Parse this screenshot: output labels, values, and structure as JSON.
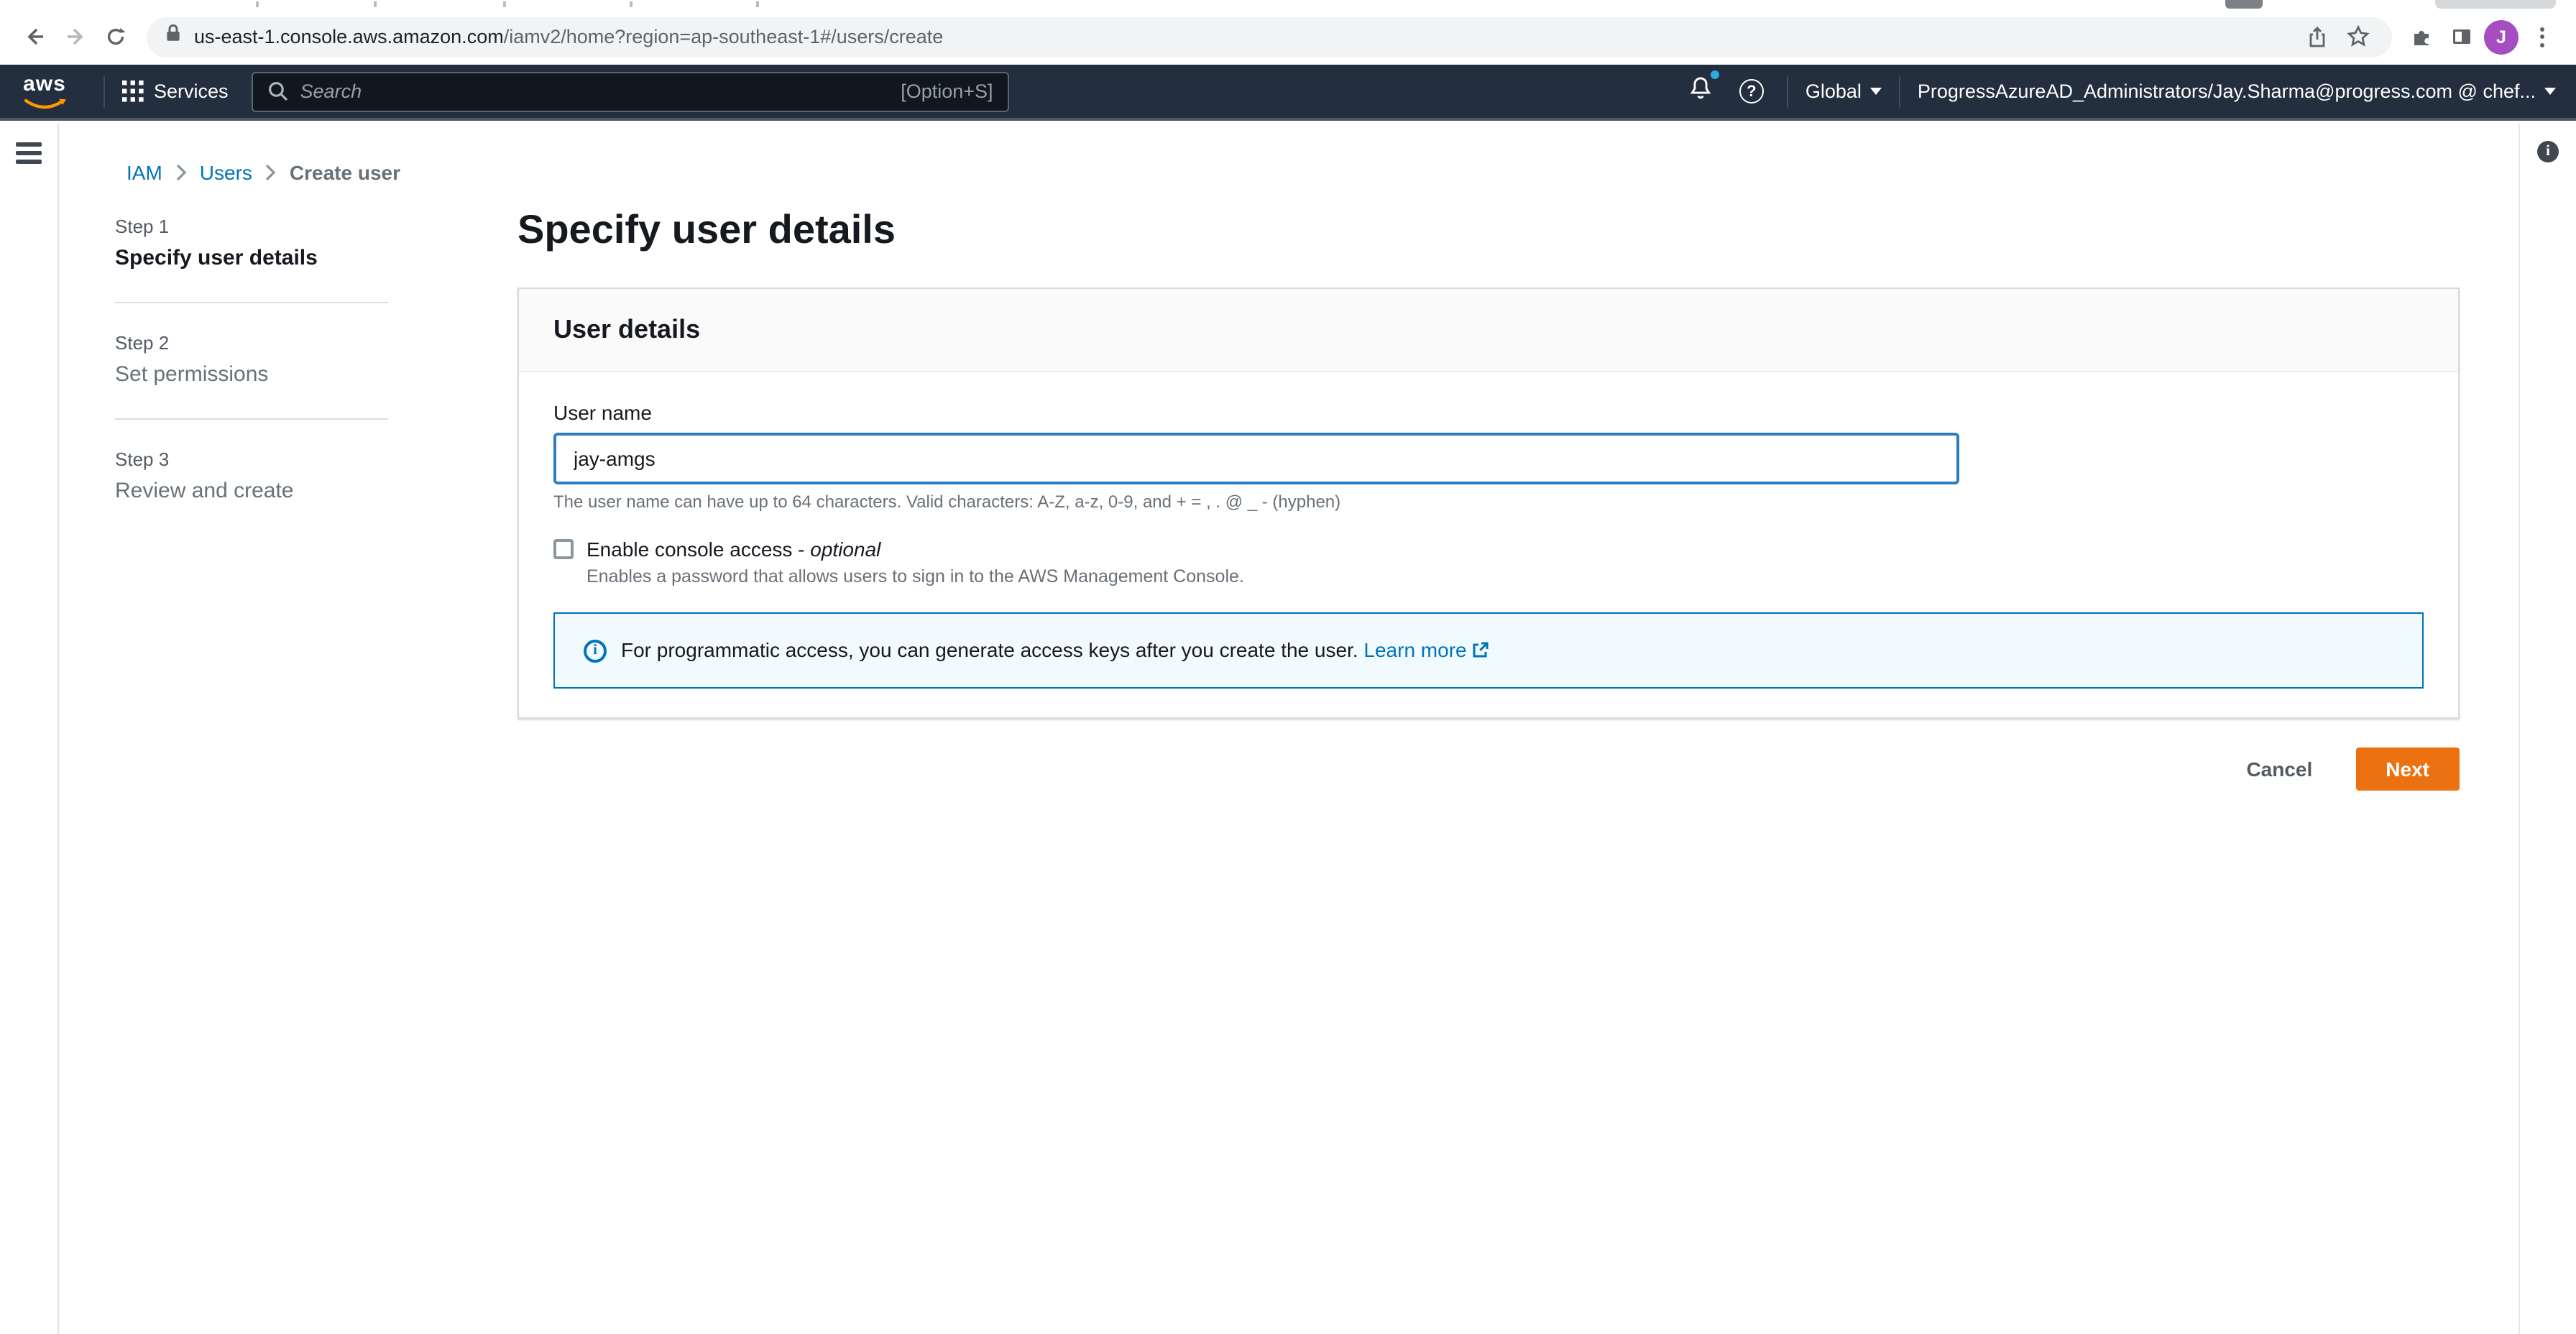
{
  "browser": {
    "url_domain": "us-east-1.console.aws.amazon.com",
    "url_path": "/iamv2/home?region=ap-southeast-1#/users/create",
    "avatar_letter": "J"
  },
  "navbar": {
    "logo_text": "aws",
    "services_label": "Services",
    "search_placeholder": "Search",
    "search_shortcut": "[Option+S]",
    "region_label": "Global",
    "account_label": "ProgressAzureAD_Administrators/Jay.Sharma@progress.com @ chef...",
    "help_glyph": "?"
  },
  "breadcrumb": {
    "items": [
      "IAM",
      "Users",
      "Create user"
    ]
  },
  "steps": [
    {
      "label": "Step 1",
      "title": "Specify user details",
      "active": true
    },
    {
      "label": "Step 2",
      "title": "Set permissions",
      "active": false
    },
    {
      "label": "Step 3",
      "title": "Review and create",
      "active": false
    }
  ],
  "main": {
    "page_title": "Specify user details",
    "card_title": "User details",
    "username_label": "User name",
    "username_value": "jay-amgs",
    "username_help": "The user name can have up to 64 characters. Valid characters: A-Z, a-z, 0-9, and + = , . @ _ - (hyphen)",
    "console_access_label": "Enable console access - ",
    "console_access_optional": "optional",
    "console_access_desc": "Enables a password that allows users to sign in to the AWS Management Console.",
    "alert_text": "For programmatic access, you can generate access keys after you create the user.",
    "alert_link_label": "Learn more",
    "cancel_label": "Cancel",
    "next_label": "Next",
    "info_glyph": "i",
    "rail_info_glyph": "i"
  },
  "colors": {
    "navbar_bg": "#232f3e",
    "aws_orange": "#ff9900",
    "primary_button": "#ec7211",
    "link_blue": "#0073bb",
    "focused_input_border": "#2e7dbe",
    "alert_bg": "#f1faff",
    "alert_border": "#0073bb",
    "notification_dot": "#2ea9e0",
    "avatar_purple": "#a64dc1"
  }
}
